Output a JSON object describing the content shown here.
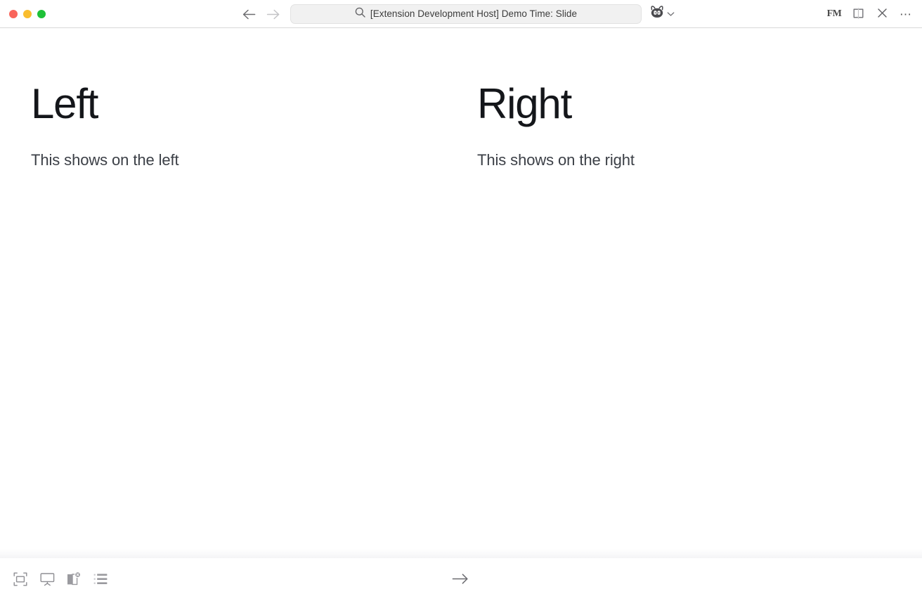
{
  "window": {
    "traffic_lights": [
      {
        "name": "close",
        "color": "#f9655b"
      },
      {
        "name": "minimize",
        "color": "#f9bd2e"
      },
      {
        "name": "maximize",
        "color": "#1ec138"
      }
    ],
    "nav": {
      "back_label": "Back",
      "forward_label": "Forward"
    },
    "search": {
      "icon": "search-icon",
      "value": "[Extension Development Host] Demo Time: Slide",
      "placeholder": "Search"
    },
    "copilot": {
      "icon": "copilot-icon",
      "chevron": "chevron-down-icon",
      "label": "Copilot"
    },
    "right_actions": [
      {
        "name": "fm-profile-icon",
        "label": "FM"
      },
      {
        "name": "split-editor-icon",
        "label": "Toggle Split Editor"
      },
      {
        "name": "close-icon",
        "label": "Close"
      },
      {
        "name": "more-actions-icon",
        "label": "More Actions"
      }
    ]
  },
  "slide": {
    "columns": [
      {
        "heading": "Left",
        "body": "This shows on the left"
      },
      {
        "heading": "Right",
        "body": "This shows on the right"
      }
    ]
  },
  "bottom_bar": {
    "tools": [
      {
        "name": "fit-to-screen-icon",
        "label": "Fit to Screen"
      },
      {
        "name": "presentation-icon",
        "label": "Start Presentation"
      },
      {
        "name": "speaker-notes-icon",
        "label": "Speaker Notes"
      },
      {
        "name": "slide-list-icon",
        "label": "Slide Overview"
      }
    ],
    "next": {
      "name": "next-slide-icon",
      "label": "Next Slide"
    }
  },
  "colors": {
    "background": "#ffffff",
    "heading": "#14161a",
    "body_text": "#3b3f46",
    "search_fill": "#f1f1f1",
    "border": "#d9d9d9",
    "icon": "#8a8a8e"
  }
}
